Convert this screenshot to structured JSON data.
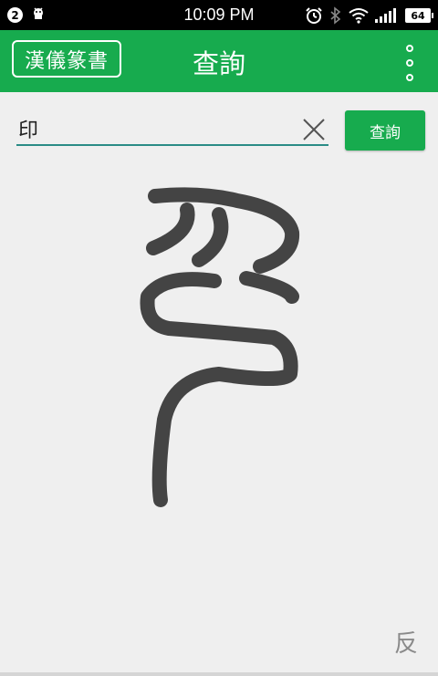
{
  "status_bar": {
    "notification_count": "2",
    "time": "10:09 PM",
    "battery": "64"
  },
  "app_bar": {
    "brand_label": "漢儀篆書",
    "title": "查詢"
  },
  "search": {
    "value": "印",
    "button_label": "查詢"
  },
  "result": {
    "glyph_icon": "seal-script-character-yin",
    "reverse_label": "反"
  },
  "colors": {
    "accent": "#17ab4e",
    "underline": "#2a8c86",
    "glyph": "#444444"
  }
}
